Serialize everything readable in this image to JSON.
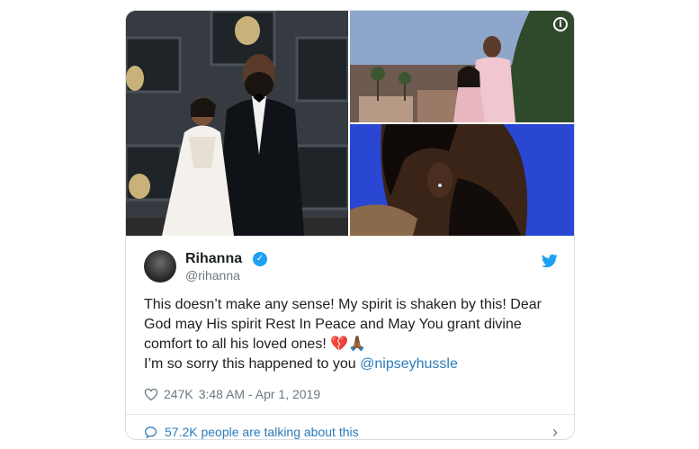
{
  "user": {
    "name": "Rihanna",
    "handle": "@rihanna"
  },
  "tweet": {
    "line1": "This doesn’t make any sense! My spirit is shaken by this! Dear",
    "line2": "God may His spirit Rest In Peace and May You grant divine",
    "line3": "comfort to all his loved ones!",
    "emoji": "💔🙏🏾",
    "line4": "I’m so sorry this happened to you",
    "mention": "@nipseyhussle"
  },
  "meta": {
    "likes": "247K",
    "timestamp": "3:48 AM - Apr 1, 2019"
  },
  "footer": {
    "talking": "57.2K people are talking about this"
  },
  "icons": {
    "heart": "heart-icon",
    "info": "info-icon",
    "verified": "verified-badge-icon",
    "twitter": "twitter-bird-icon",
    "comment": "comment-bubble-icon",
    "chevron": "chevron-right-icon"
  },
  "colors": {
    "link": "#2b7bb9",
    "brand": "#1da1f2",
    "muted": "#697882",
    "border": "#d8dfe4"
  }
}
